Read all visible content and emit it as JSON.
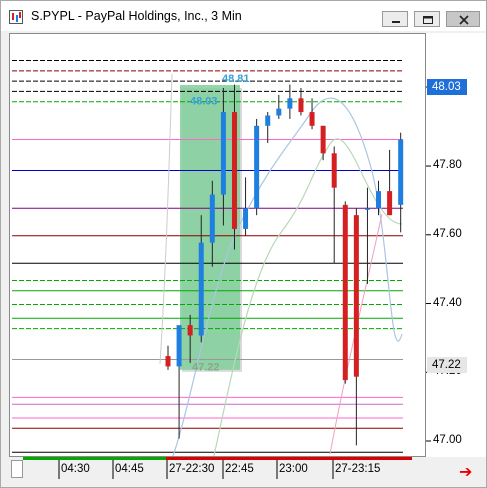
{
  "window": {
    "title": "S.PYPL - PayPal Holdings, Inc., 3 Min",
    "controls": [
      "minimize",
      "restore",
      "close"
    ]
  },
  "chart_data": {
    "type": "candlestick",
    "symbol": "S.PYPL",
    "interval": "3 Min",
    "y_ticks": [
      "48.03",
      "47.80",
      "47.60",
      "47.40",
      "47.20",
      "47.00"
    ],
    "ylim": [
      46.93,
      48.14
    ],
    "price_labels": {
      "last": "48.03",
      "lower": "47.22"
    },
    "x_ticks": [
      "04:30",
      "04:45",
      "27-22:30",
      "22:45",
      "23:00",
      "27-23:15"
    ],
    "annotations": {
      "box_top": "48.03",
      "box_high": "48.81",
      "box_bottom": "47.22"
    },
    "candles": [
      {
        "o": 47.25,
        "h": 47.28,
        "l": 47.21,
        "c": 47.22
      },
      {
        "o": 47.22,
        "h": 47.33,
        "l": 47.01,
        "c": 47.34
      },
      {
        "o": 47.34,
        "h": 47.37,
        "l": 47.23,
        "c": 47.31
      },
      {
        "o": 47.31,
        "h": 47.66,
        "l": 47.29,
        "c": 47.58
      },
      {
        "o": 47.58,
        "h": 47.76,
        "l": 47.51,
        "c": 47.72
      },
      {
        "o": 47.72,
        "h": 48.03,
        "l": 47.63,
        "c": 47.96
      },
      {
        "o": 47.96,
        "h": 48.04,
        "l": 47.56,
        "c": 47.62
      },
      {
        "o": 47.62,
        "h": 47.77,
        "l": 47.6,
        "c": 47.68
      },
      {
        "o": 47.68,
        "h": 47.94,
        "l": 47.66,
        "c": 47.92
      },
      {
        "o": 47.92,
        "h": 47.96,
        "l": 47.87,
        "c": 47.95
      },
      {
        "o": 47.95,
        "h": 48.01,
        "l": 47.94,
        "c": 47.97
      },
      {
        "o": 47.97,
        "h": 48.04,
        "l": 47.94,
        "c": 48.0
      },
      {
        "o": 48.0,
        "h": 48.03,
        "l": 47.95,
        "c": 47.96
      },
      {
        "o": 47.96,
        "h": 48.0,
        "l": 47.91,
        "c": 47.92
      },
      {
        "o": 47.92,
        "h": 47.92,
        "l": 47.82,
        "c": 47.84
      },
      {
        "o": 47.84,
        "h": 47.86,
        "l": 47.52,
        "c": 47.74
      },
      {
        "o": 47.69,
        "h": 47.7,
        "l": 47.17,
        "c": 47.18
      },
      {
        "o": 47.66,
        "h": 47.68,
        "l": 46.99,
        "c": 47.19
      },
      {
        "o": 47.68,
        "h": 47.74,
        "l": 47.46,
        "c": 47.68
      },
      {
        "o": 47.68,
        "h": 47.76,
        "l": 47.66,
        "c": 47.73
      },
      {
        "o": 47.73,
        "h": 47.85,
        "l": 47.66,
        "c": 47.66
      },
      {
        "o": 47.69,
        "h": 47.9,
        "l": 47.61,
        "c": 47.88
      }
    ],
    "horizontal_lines": [
      {
        "price": 48.11,
        "color": "#000000",
        "style": "dashed"
      },
      {
        "price": 48.08,
        "color": "#8b0000",
        "style": "dashed"
      },
      {
        "price": 48.05,
        "color": "#000000",
        "style": "dashed"
      },
      {
        "price": 48.02,
        "color": "#000000",
        "style": "dashed"
      },
      {
        "price": 47.99,
        "color": "#00aa00",
        "style": "dashed"
      },
      {
        "price": 47.88,
        "color": "#ff66cc",
        "style": "solid"
      },
      {
        "price": 47.79,
        "color": "#0000cc",
        "style": "solid"
      },
      {
        "price": 47.68,
        "color": "#800080",
        "style": "solid"
      },
      {
        "price": 47.6,
        "color": "#8b0000",
        "style": "solid"
      },
      {
        "price": 47.52,
        "color": "#000000",
        "style": "solid"
      },
      {
        "price": 47.47,
        "color": "#00aa00",
        "style": "dashed"
      },
      {
        "price": 47.44,
        "color": "#00aa00",
        "style": "solid"
      },
      {
        "price": 47.4,
        "color": "#00aa00",
        "style": "dashed"
      },
      {
        "price": 47.36,
        "color": "#00aa00",
        "style": "solid"
      },
      {
        "price": 47.33,
        "color": "#00aa00",
        "style": "dashed"
      },
      {
        "price": 47.24,
        "color": "#999999",
        "style": "solid"
      },
      {
        "price": 47.13,
        "color": "#ff66cc",
        "style": "solid"
      },
      {
        "price": 47.11,
        "color": "#cc66cc",
        "style": "solid"
      },
      {
        "price": 47.07,
        "color": "#ff66cc",
        "style": "solid"
      },
      {
        "price": 47.04,
        "color": "#8b0000",
        "style": "solid"
      },
      {
        "price": 46.97,
        "color": "#000000",
        "style": "solid"
      }
    ],
    "colors": {
      "up": "#1e7fe0",
      "down": "#d42020",
      "zone": "#7fcf9a",
      "time_bar_left": "#00aa00",
      "time_bar_right": "#dd0000"
    }
  }
}
